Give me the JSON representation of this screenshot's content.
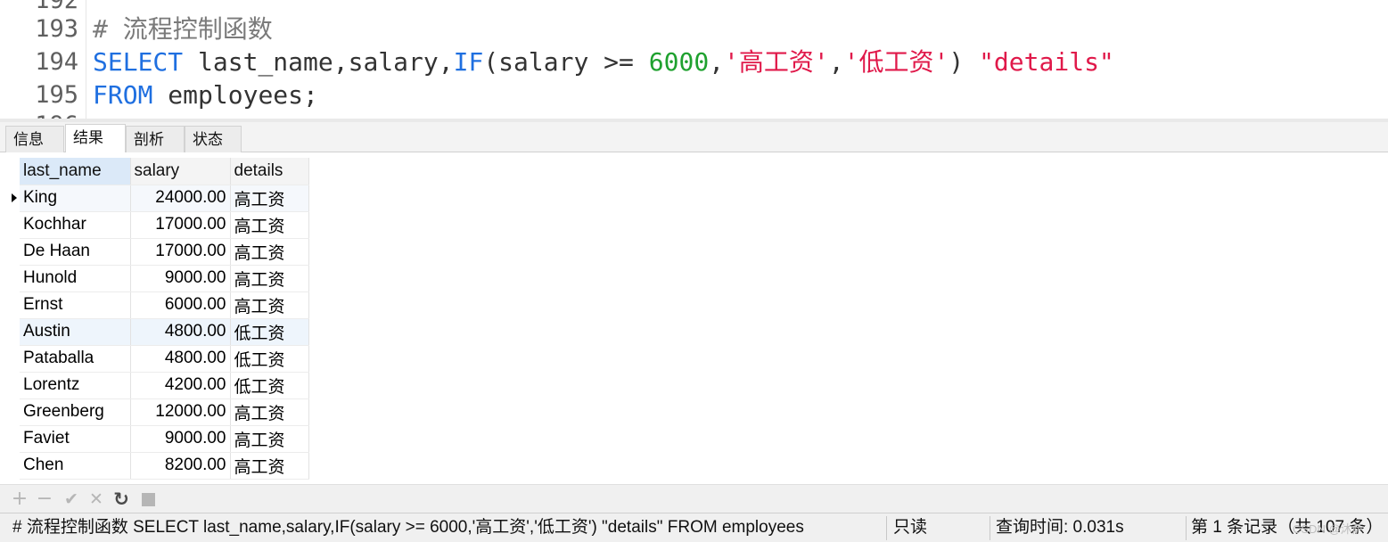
{
  "editor": {
    "partial_top_line": "192",
    "partial_bottom_line": "196",
    "lines": [
      {
        "number": "193",
        "comment": "# 流程控制函数"
      },
      {
        "number": "194",
        "kw_select": "SELECT",
        "cols": " last_name,salary,",
        "kw_if": "IF",
        "cond_open": "(salary >= ",
        "num": "6000",
        "comma1": ",",
        "str_high": "'高工资'",
        "comma2": ",",
        "str_low": "'低工资'",
        "close": ") ",
        "alias": "\"details\""
      },
      {
        "number": "195",
        "kw_from": "FROM",
        "table": " employees;"
      }
    ]
  },
  "tabs": [
    {
      "label": "信息",
      "active": false
    },
    {
      "label": "结果 1",
      "active": true
    },
    {
      "label": "剖析",
      "active": false
    },
    {
      "label": "状态",
      "active": false
    }
  ],
  "grid": {
    "columns": [
      "last_name",
      "salary",
      "details"
    ],
    "rows": [
      {
        "last_name": "King",
        "salary": "24000.00",
        "details": "高工资"
      },
      {
        "last_name": "Kochhar",
        "salary": "17000.00",
        "details": "高工资"
      },
      {
        "last_name": "De Haan",
        "salary": "17000.00",
        "details": "高工资"
      },
      {
        "last_name": "Hunold",
        "salary": "9000.00",
        "details": "高工资"
      },
      {
        "last_name": "Ernst",
        "salary": "6000.00",
        "details": "高工资"
      },
      {
        "last_name": "Austin",
        "salary": "4800.00",
        "details": "低工资"
      },
      {
        "last_name": "Pataballa",
        "salary": "4800.00",
        "details": "低工资"
      },
      {
        "last_name": "Lorentz",
        "salary": "4200.00",
        "details": "低工资"
      },
      {
        "last_name": "Greenberg",
        "salary": "12000.00",
        "details": "高工资"
      },
      {
        "last_name": "Faviet",
        "salary": "9000.00",
        "details": "高工资"
      },
      {
        "last_name": "Chen",
        "salary": "8200.00",
        "details": "高工资"
      }
    ]
  },
  "toolbar": {
    "add": "+",
    "remove": "−",
    "apply": "✔",
    "discard": "✕",
    "refresh": "↻"
  },
  "status": {
    "query": "# 流程控制函数 SELECT last_name,salary,IF(salary >= 6000,'高工资','低工资') \"details\" FROM employees",
    "mode": "只读",
    "query_time": "查询时间: 0.031s",
    "record": "第 1 条记录（共 107 条）"
  },
  "watermark": "CSDN @沐萨"
}
